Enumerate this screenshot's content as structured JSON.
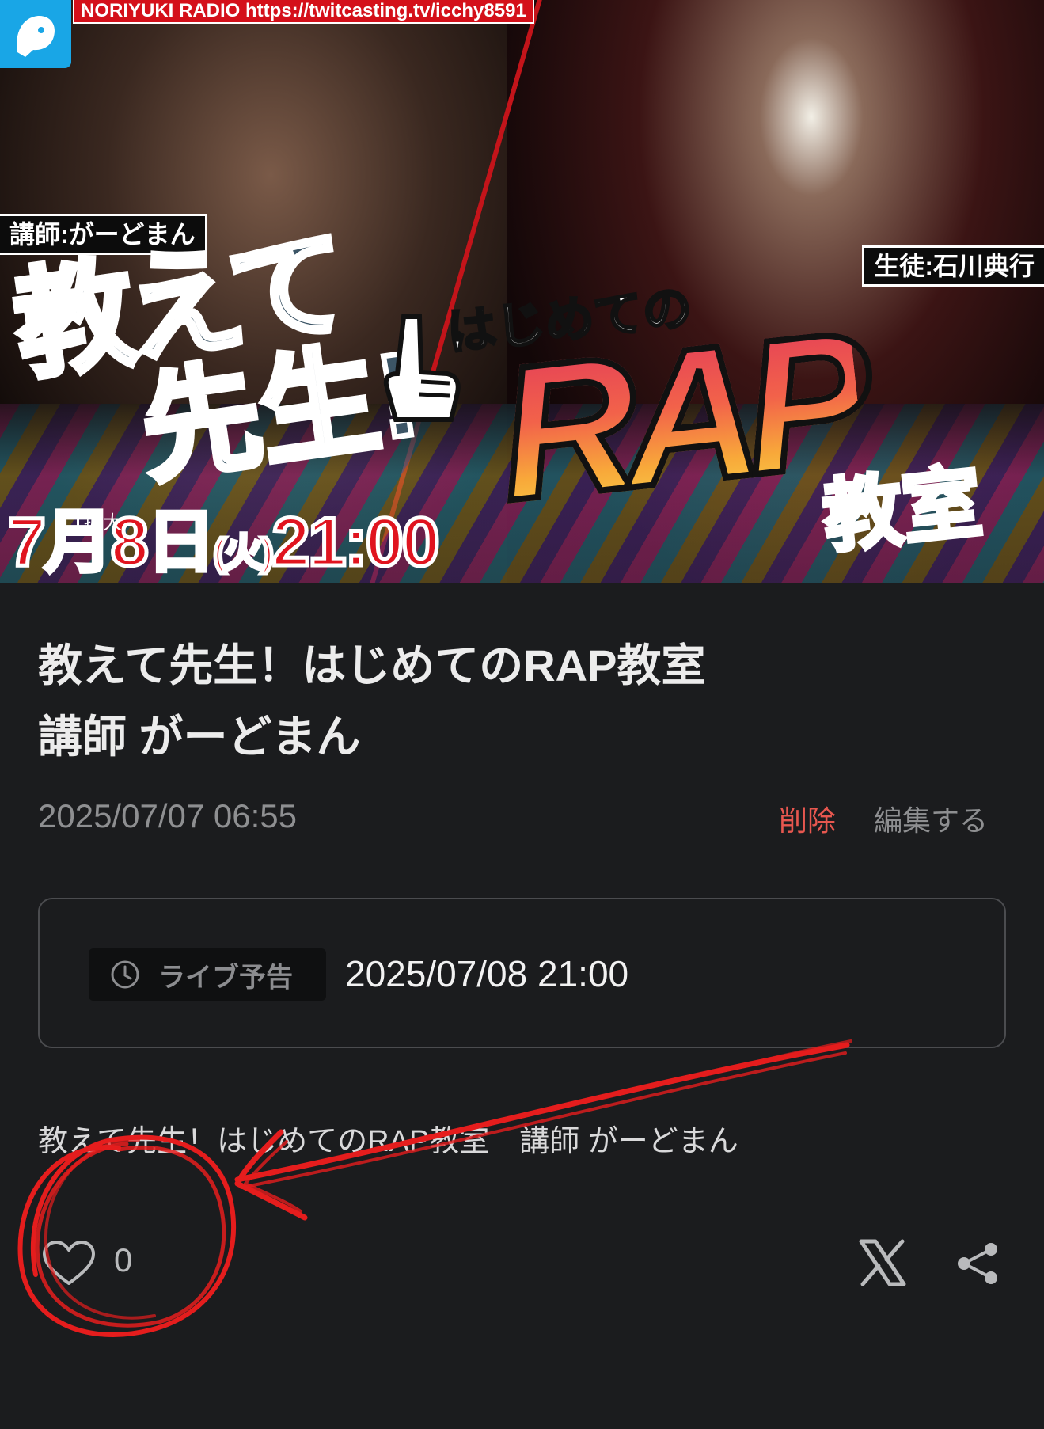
{
  "banner": {
    "channel_bar": "NORIYUKI RADIO  https://twitcasting.tv/icchy8591",
    "teacher_tag": "講師:がーどまん",
    "student_tag": "生徒:石川典行",
    "headline_1": "教えて",
    "headline_2": "先生!",
    "headline_3": "はじめての",
    "headline_rap": "RAP",
    "headline_4": "教室",
    "date_main": "7月8日",
    "date_day": "(火)",
    "date_time": "21:00",
    "enlarge_label": "拡大"
  },
  "post": {
    "title": "教えて先生！はじめてのRAP教室　講師 がーどまん",
    "posted_at": "2025/07/07 06:55",
    "delete_label": "削除",
    "edit_label": "編集する",
    "live_badge_label": "ライブ予告",
    "live_datetime": "2025/07/08 21:00",
    "description": "教えて先生！はじめてのRAP教室　講師 がーどまん",
    "like_count": "0"
  },
  "icons": [
    "twitcasting-logo-icon",
    "clock-icon",
    "heart-icon",
    "x-logo-icon",
    "share-icon"
  ],
  "colors": {
    "background": "#1b1c1e",
    "delete": "#e7574f",
    "muted": "#8e8f91",
    "annotation": "#e51d1d"
  }
}
